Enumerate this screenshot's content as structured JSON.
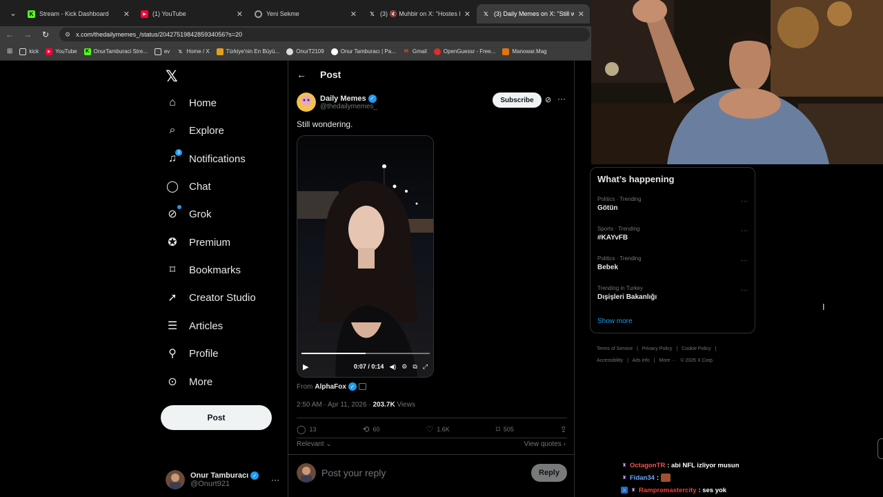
{
  "browser": {
    "tabs": [
      {
        "title": "Stream - Kick Dashboard",
        "icon": "kick-icon",
        "color": "#53fc18"
      },
      {
        "title": "(1) YouTube",
        "icon": "youtube-icon",
        "color": "#ff0033"
      },
      {
        "title": "Yeni Sekme",
        "icon": "chrome-icon",
        "color": "#9aa0a6"
      },
      {
        "title": "(3) 🔇 Muhbir on X: \"Hostes Es...",
        "icon": "x-icon",
        "color": "#ffffff"
      },
      {
        "title": "(3) Daily Memes on X: \"Still won...",
        "icon": "x-icon",
        "color": "#ffffff"
      }
    ],
    "url": "x.com/thedailymemes_/status/2042751984285934056?s=20",
    "bookmarks": [
      {
        "label": "kick",
        "icon": "folder-icon",
        "color": "#5f6368"
      },
      {
        "label": "YouTube",
        "icon": "youtube-icon",
        "color": "#ff0033"
      },
      {
        "label": "OnurTamburaci Stre...",
        "icon": "kick-icon",
        "color": "#53fc18"
      },
      {
        "label": "ev",
        "icon": "folder-icon",
        "color": "#5f6368"
      },
      {
        "label": "Home / X",
        "icon": "x-icon",
        "color": "#222222"
      },
      {
        "label": "Türkiye'nin En Büyü...",
        "icon": "site-icon",
        "color": "#e3a21a"
      },
      {
        "label": "OnurT2109",
        "icon": "github-icon",
        "color": "#444444"
      },
      {
        "label": "Onur Tamburacı | Pa...",
        "icon": "patreon-icon",
        "color": "#222222"
      },
      {
        "label": "Gmail",
        "icon": "gmail-icon",
        "color": "#ea4335"
      },
      {
        "label": "OpenGuessr - Free...",
        "icon": "openguessr-icon",
        "color": "#d93025"
      },
      {
        "label": "Manowar.Mag",
        "icon": "site-icon",
        "color": "#e8710a"
      }
    ]
  },
  "nav": {
    "items": [
      {
        "label": "Home",
        "icon": "home-icon"
      },
      {
        "label": "Explore",
        "icon": "search-icon"
      },
      {
        "label": "Notifications",
        "icon": "bell-icon",
        "badge": "3"
      },
      {
        "label": "Chat",
        "icon": "chat-icon"
      },
      {
        "label": "Grok",
        "icon": "grok-icon"
      },
      {
        "label": "Premium",
        "icon": "premium-icon"
      },
      {
        "label": "Bookmarks",
        "icon": "bookmark-icon"
      },
      {
        "label": "Creator Studio",
        "icon": "rocket-icon"
      },
      {
        "label": "Articles",
        "icon": "articles-icon"
      },
      {
        "label": "Profile",
        "icon": "person-icon"
      },
      {
        "label": "More",
        "icon": "more-circle-icon"
      }
    ],
    "post_label": "Post",
    "account": {
      "name": "Onur Tamburacı",
      "handle": "@Onurt921"
    }
  },
  "post": {
    "header_title": "Post",
    "author_name": "Daily Memes",
    "author_handle": "@thedailymemes_",
    "subscribe_label": "Subscribe",
    "text": "Still wondering.",
    "video": {
      "time": "0:07 / 0:14",
      "progress": 0.5
    },
    "from_label": "From",
    "from_name": "AlphaFox",
    "timestamp": "2:50 AM · Apr 11, 2026 ·",
    "views_count": "203.7K",
    "views_label": "Views",
    "replies": "13",
    "reposts": "60",
    "likes": "1.6K",
    "bookmarks": "505",
    "relevant_label": "Relevant",
    "view_quotes_label": "View quotes",
    "reply_placeholder": "Post your reply",
    "reply_button": "Reply"
  },
  "trends": {
    "title": "What’s happening",
    "items": [
      {
        "category": "Politics · Trending",
        "name": "Götün"
      },
      {
        "category": "Sports · Trending",
        "name": "#KAYvFB"
      },
      {
        "category": "Politics · Trending",
        "name": "Bebek"
      },
      {
        "category": "Trending in Turkey",
        "name": "Dışişleri Bakanlığı"
      }
    ],
    "show_more": "Show more"
  },
  "footer": {
    "links": [
      "Terms of Service",
      "|",
      "Privacy Policy",
      "|",
      "Cookie Policy",
      "|",
      "Accessibility",
      "|",
      "Ads info",
      "|",
      "More ···",
      "© 2026 X Corp."
    ]
  },
  "chat": [
    {
      "user": "OctagonTR",
      "color": "#ff4d4d",
      "message": ": abi NFL izliyor musun"
    },
    {
      "user": "Fidan34",
      "color": "#6fa8ff",
      "message": ":"
    },
    {
      "user": "Rampromastercity",
      "color": "#ff3b3b",
      "message": ": ses yok"
    }
  ]
}
